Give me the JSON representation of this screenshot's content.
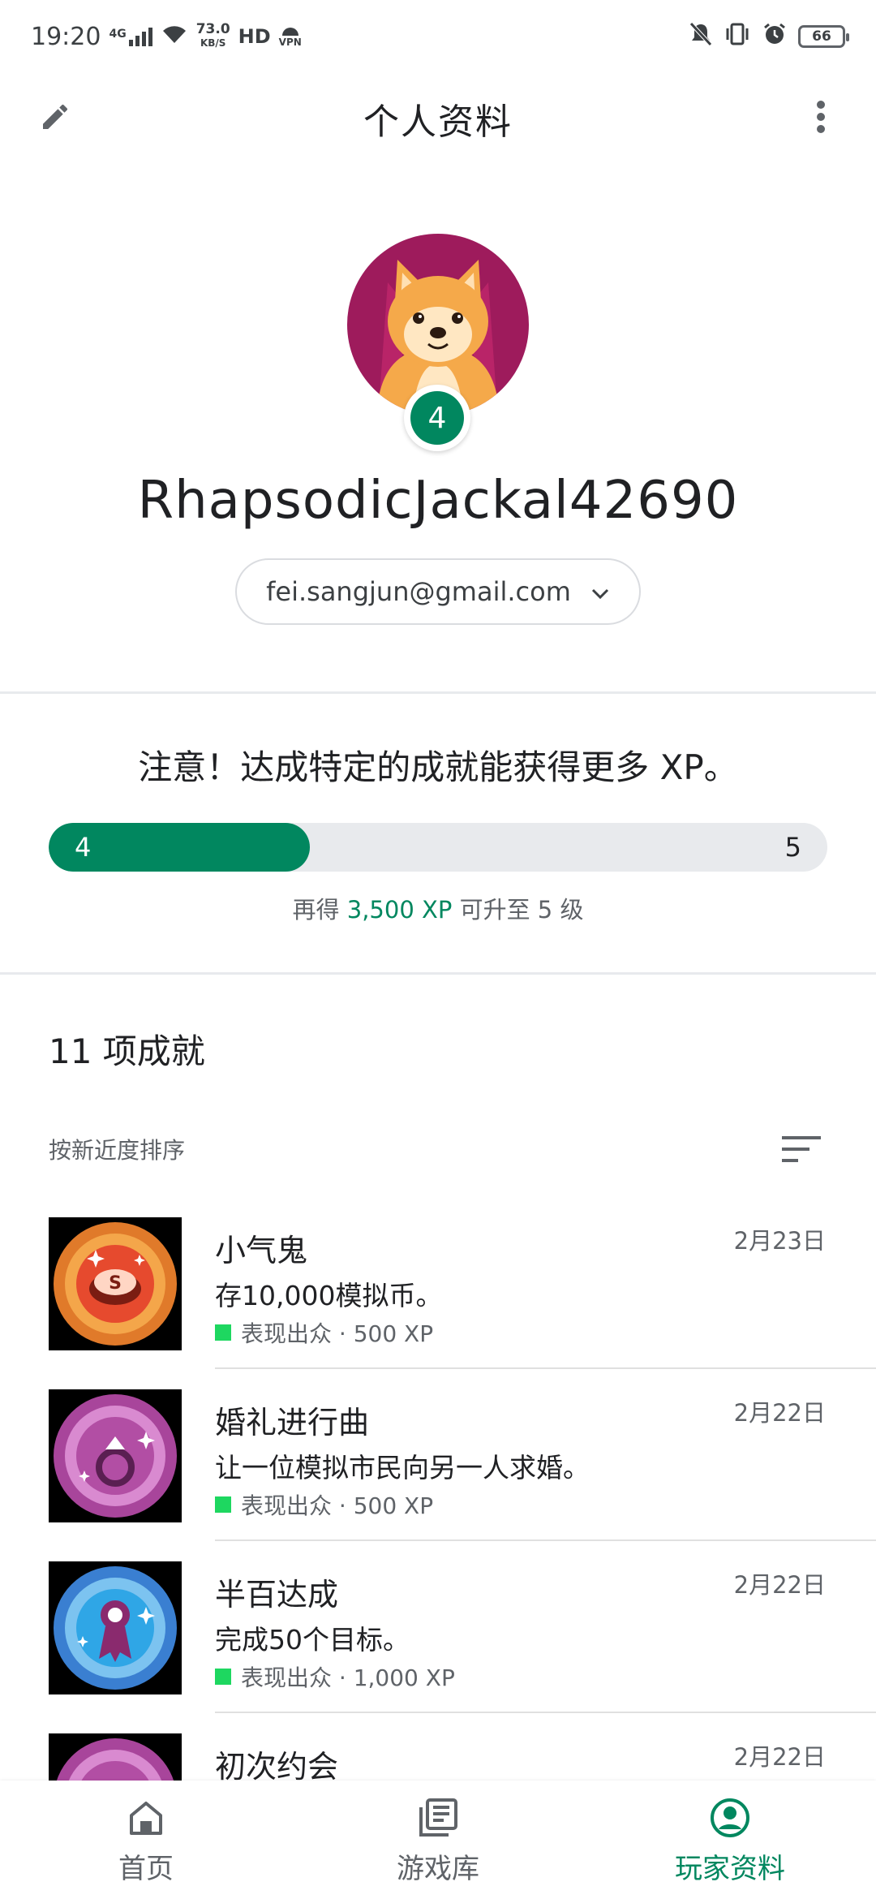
{
  "status_bar": {
    "time": "19:20",
    "network": "4G",
    "speed": "73.0",
    "speed_unit": "KB/S",
    "hd": "HD",
    "vpn": "VPN",
    "battery": "66"
  },
  "app_bar": {
    "title": "个人资料",
    "edit_icon": "pencil-icon",
    "more_icon": "more-vert-icon"
  },
  "profile": {
    "level": "4",
    "username": "RhapsodicJackal42690",
    "email": "fei.sangjun@gmail.com"
  },
  "xp": {
    "note": "注意！达成特定的成就能获得更多 XP。",
    "current_level": "4",
    "next_level": "5",
    "progress_fraction": 0.335,
    "sub_prefix": "再得",
    "sub_amount": "3,500 XP",
    "sub_suffix": "可升至 5 级"
  },
  "achievements": {
    "heading": "11 项成就",
    "sort_label": "按新近度排序",
    "items": [
      {
        "title": "小气鬼",
        "date": "2月23日",
        "description": "存10,000模拟币。",
        "meta": "表现出众 · 500 XP"
      },
      {
        "title": "婚礼进行曲",
        "date": "2月22日",
        "description": "让一位模拟市民向另一人求婚。",
        "meta": "表现出众 · 500 XP"
      },
      {
        "title": "半百达成",
        "date": "2月22日",
        "description": "完成50个目标。",
        "meta": "表现出众 · 1,000 XP"
      },
      {
        "title": "初次约会",
        "date": "2月22日",
        "description": "",
        "meta": ""
      }
    ]
  },
  "bottom_nav": {
    "items": [
      {
        "label": "首页",
        "icon": "home-icon"
      },
      {
        "label": "游戏库",
        "icon": "library-icon"
      },
      {
        "label": "玩家资料",
        "icon": "account-icon"
      }
    ]
  },
  "colors": {
    "accent": "#01875f",
    "rarity": "#1ed760"
  }
}
